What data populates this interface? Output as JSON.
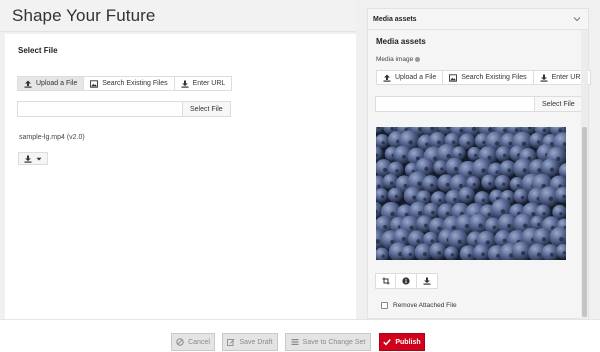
{
  "page": {
    "title": "Shape Your Future"
  },
  "left": {
    "section_title": "Select File",
    "tabs": [
      {
        "label": "Upload a File",
        "icon": "upload-icon",
        "active": true
      },
      {
        "label": "Search Existing Files",
        "icon": "image-icon",
        "active": false
      },
      {
        "label": "Enter URL",
        "icon": "download-icon",
        "active": false
      }
    ],
    "file_input_value": "",
    "select_file_label": "Select File",
    "file_name": "sample-lg.mp4 (v2.0)"
  },
  "right": {
    "accordion_title": "Media assets",
    "heading": "Media assets",
    "field_label": "Media image",
    "tabs": [
      {
        "label": "Upload a File",
        "icon": "upload-icon"
      },
      {
        "label": "Search Existing Files",
        "icon": "image-icon"
      },
      {
        "label": "Enter URL",
        "icon": "download-icon"
      }
    ],
    "file_input_value": "",
    "select_file_label": "Select File",
    "image_subject": "blueberries",
    "remove_label": "Remove Attached File"
  },
  "footer": {
    "cancel": "Cancel",
    "save_draft": "Save Draft",
    "save_change_set": "Save to Change Set",
    "publish": "Publish"
  },
  "colors": {
    "accent": "#d0021b",
    "berry": "#3f4f78"
  }
}
